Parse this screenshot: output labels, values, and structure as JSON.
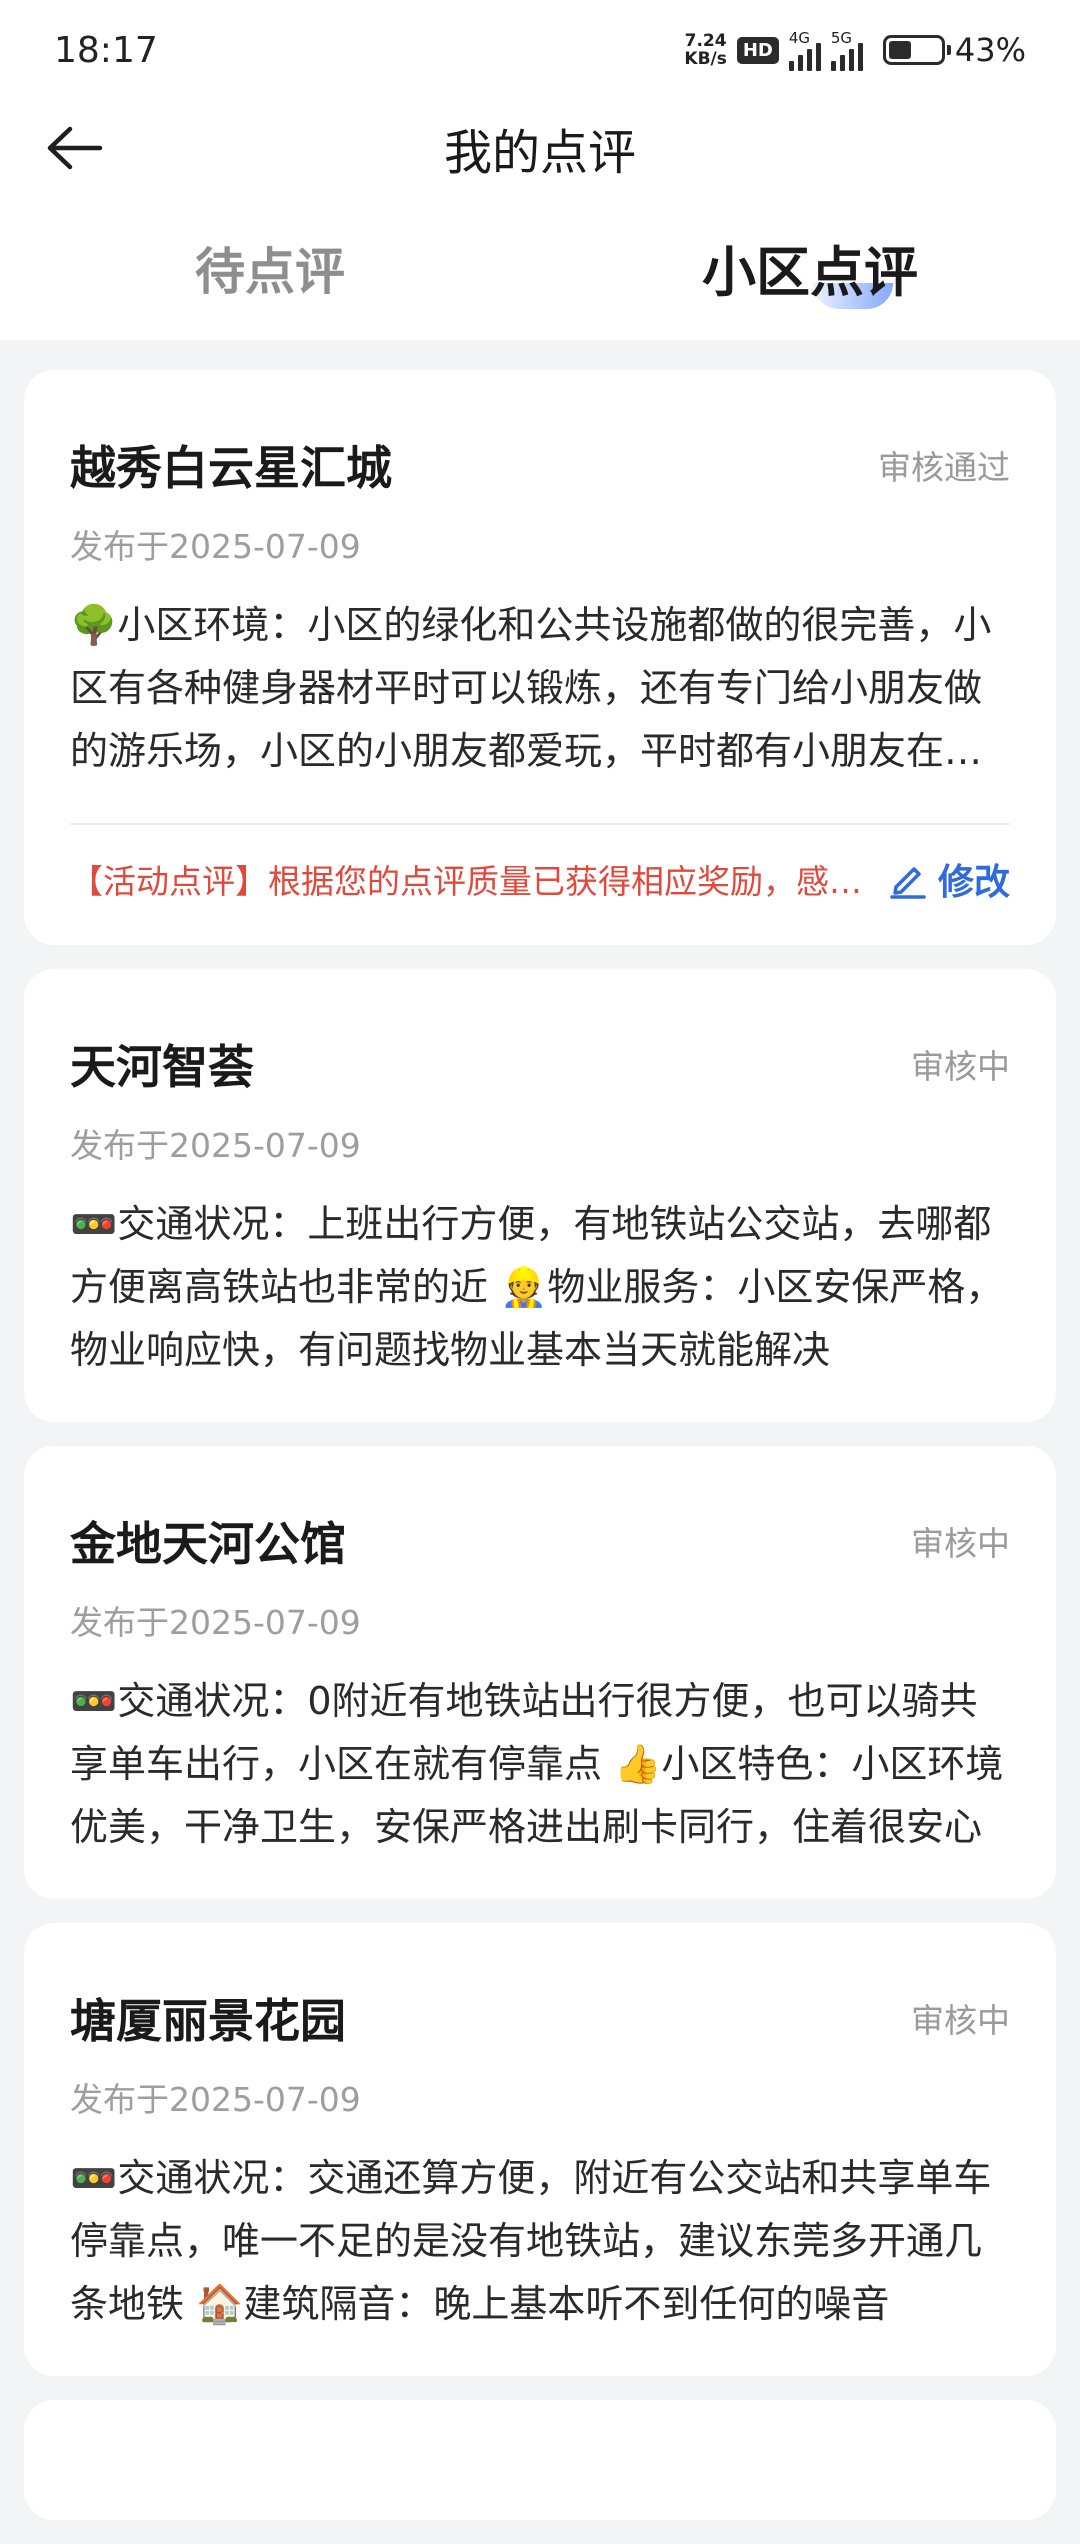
{
  "status_bar": {
    "time": "18:17",
    "net_speed_value": "7.24",
    "net_speed_unit": "KB/s",
    "hd_label": "HD",
    "signal1_label": "4G",
    "signal2_label": "5G",
    "battery_percent": 43,
    "battery_text": "43%"
  },
  "header": {
    "title": "我的点评",
    "back_icon": "arrow-left-icon"
  },
  "tabs": [
    {
      "label": "待点评",
      "active": false
    },
    {
      "label": "小区点评",
      "active": true
    }
  ],
  "colors": {
    "accent": "#2f6bdc",
    "activity": "#e0493c",
    "muted": "#9a9a9a",
    "background": "#f3f4f6"
  },
  "reviews": [
    {
      "title": "越秀白云星汇城",
      "status": "审核通过",
      "date": "发布于2025-07-09",
      "content": "🌳小区环境：小区的绿化和公共设施都做的很完善，小区有各种健身器材平时可以锻炼，还有专门给小朋友做的游乐场，小区的小朋友都爱玩，平时都有小朋友在这里玩耍",
      "activity": "【活动点评】根据您的点评质量已获得相应奖励，感谢您的参与",
      "edit_label": "修改",
      "edit_icon": "edit-pen-icon"
    },
    {
      "title": "天河智荟",
      "status": "审核中",
      "date": "发布于2025-07-09",
      "content": "🚥交通状况：上班出行方便，有地铁站公交站，去哪都方便离高铁站也非常的近 👷物业服务：小区安保严格，物业响应快，有问题找物业基本当天就能解决"
    },
    {
      "title": "金地天河公馆",
      "status": "审核中",
      "date": "发布于2025-07-09",
      "content": "🚥交通状况：0附近有地铁站出行很方便，也可以骑共享单车出行，小区在就有停靠点 👍小区特色：小区环境优美，干净卫生，安保严格进出刷卡同行，住着很安心"
    },
    {
      "title": "塘厦丽景花园",
      "status": "审核中",
      "date": "发布于2025-07-09",
      "content": "🚥交通状况：交通还算方便，附近有公交站和共享单车停靠点，唯一不足的是没有地铁站，建议东莞多开通几条地铁 🏠建筑隔音：晚上基本听不到任何的噪音"
    }
  ]
}
